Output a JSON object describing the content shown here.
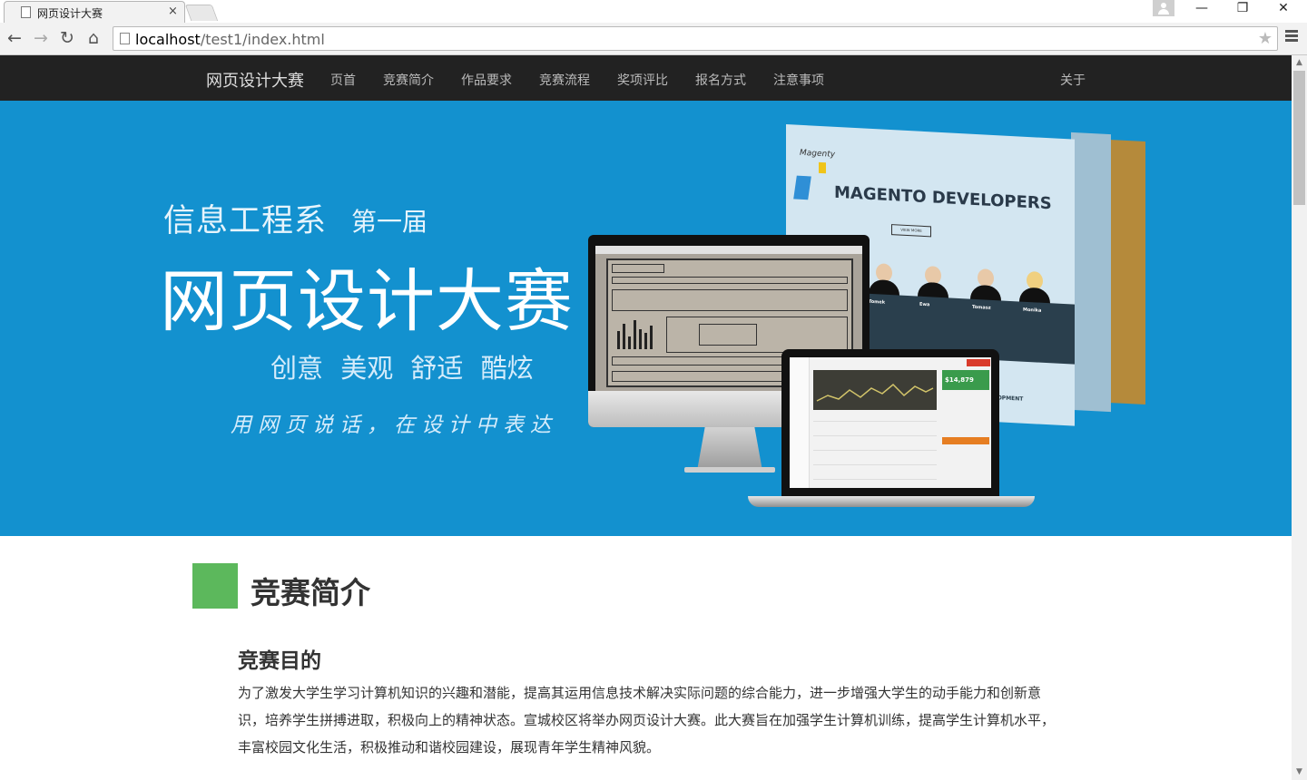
{
  "browser": {
    "tab_title": "网页设计大赛",
    "tab_close": "×",
    "url_host": "localhost",
    "url_path": "/test1/index.html",
    "win_minimize": "—",
    "win_restore": "❐",
    "win_close": "✕",
    "back_icon": "←",
    "forward_icon": "→",
    "reload_icon": "↻",
    "home_icon": "⌂",
    "star_icon": "★"
  },
  "navbar": {
    "brand": "网页设计大赛",
    "items": [
      "页首",
      "竞赛简介",
      "作品要求",
      "竞赛流程",
      "奖项评比",
      "报名方式",
      "注意事项"
    ],
    "about": "关于"
  },
  "hero": {
    "line1": "信息工程系",
    "line1b": "第一届",
    "title": "网页设计大赛",
    "words": "创意 美观 舒适 酷炫",
    "slogan": "用网页说话，在设计中表达",
    "bg_color": "#1391cf",
    "mockup": {
      "site_logo": "Magenty",
      "site_heading": "MAGENTO DEVELOPERS",
      "site_button": "VIEW MORE",
      "team": [
        {
          "name": "Tomek"
        },
        {
          "name": "Ewa"
        },
        {
          "name": "Tomasz"
        },
        {
          "name": "Monika"
        }
      ],
      "site_footer": "ELOPMENT",
      "laptop_amount": "$14,879"
    }
  },
  "content": {
    "section_title": "竞赛简介",
    "accent_color": "#5cb85c",
    "purpose_title": "竞赛目的",
    "purpose_text": "为了激发大学生学习计算机知识的兴趣和潜能，提高其运用信息技术解决实际问题的综合能力，进一步增强大学生的动手能力和创新意识，培养学生拼搏进取，积极向上的精神状态。宣城校区将举办网页设计大赛。此大赛旨在加强学生计算机训练，提高学生计算机水平，丰富校园文化生活，积极推动和谐校园建设，展现青年学生精神风貌。"
  }
}
